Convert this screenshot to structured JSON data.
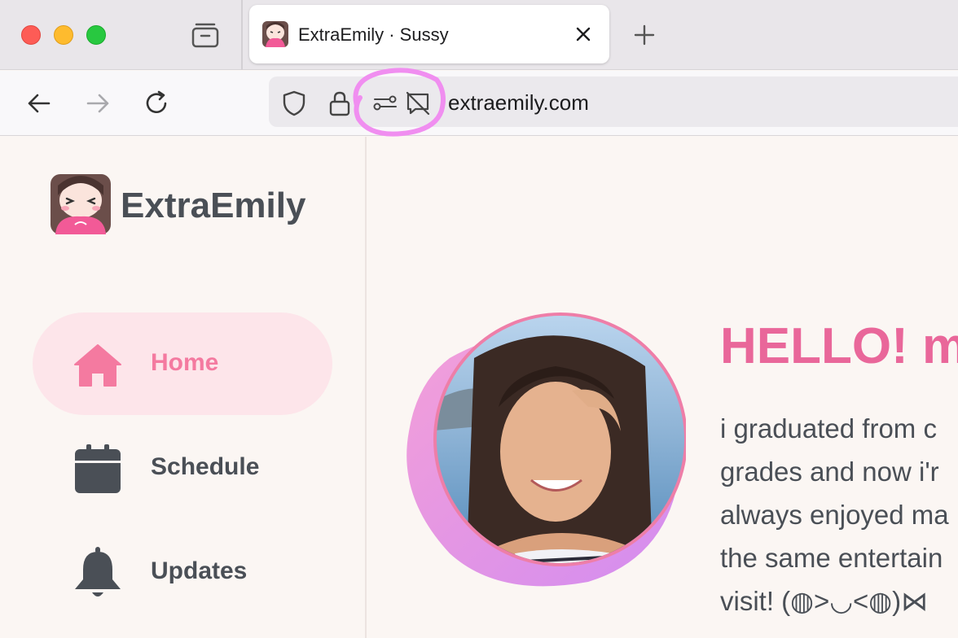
{
  "browser": {
    "tab": {
      "title": "ExtraEmily · Sussy"
    },
    "url": "extraemily.com",
    "icons": {
      "back": "arrow-left-icon",
      "forward": "arrow-right-icon",
      "reload": "reload-icon",
      "shield": "shield-icon",
      "lock": "lock-icon",
      "permissions": "permissions-sliders-icon",
      "notifications": "notifications-blocked-icon"
    }
  },
  "sidebar": {
    "brand": "ExtraEmily",
    "items": [
      {
        "label": "Home",
        "icon": "home-icon",
        "active": true
      },
      {
        "label": "Schedule",
        "icon": "calendar-icon",
        "active": false
      },
      {
        "label": "Updates",
        "icon": "bell-icon",
        "active": false
      }
    ]
  },
  "main": {
    "heading": "HELLO! m",
    "body_lines": [
      "i graduated from c",
      "grades and now i'r",
      "always enjoyed ma",
      "the same entertain",
      "visit! (◍>◡<◍)⋈"
    ]
  },
  "colors": {
    "accent_pink": "#e9679a",
    "nav_active_bg": "#fde5ea",
    "text_dark": "#4a4f56",
    "highlight_magenta": "#f08ef0"
  }
}
